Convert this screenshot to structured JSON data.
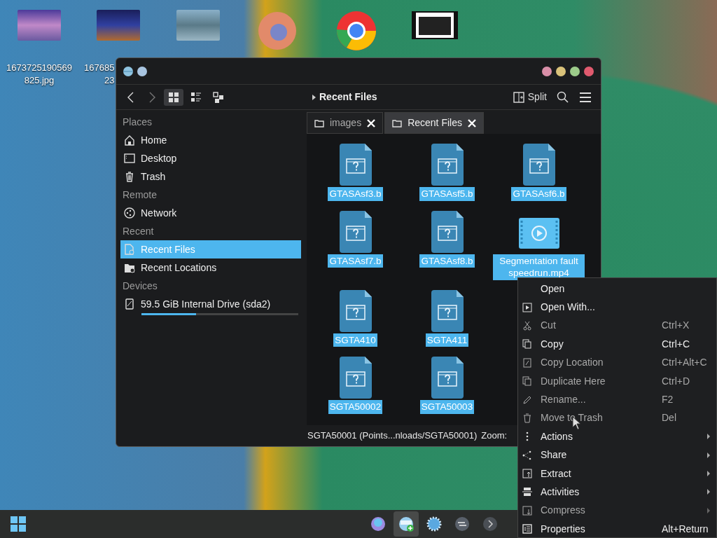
{
  "desktop_icons": [
    {
      "kind": "photo",
      "label_lines": [
        "1673725190569",
        "825.jpg"
      ]
    },
    {
      "kind": "photo",
      "label_lines": [
        "167685",
        "23"
      ]
    },
    {
      "kind": "photo"
    },
    {
      "kind": "browser-fox"
    },
    {
      "kind": "browser-ring"
    },
    {
      "kind": "video"
    }
  ],
  "window": {
    "breadcrumb": "Recent Files",
    "split_label": "Split",
    "view_modes": [
      {
        "kind": "icons",
        "selected": true
      },
      {
        "kind": "details",
        "selected": false
      },
      {
        "kind": "tree",
        "selected": false
      }
    ],
    "window_buttons": [
      {
        "color": "#d98fa8"
      },
      {
        "color": "#d9c27a"
      },
      {
        "color": "#9ccb8a"
      },
      {
        "color": "#e05a6e"
      }
    ]
  },
  "sidebar": {
    "sections": [
      {
        "heading": "Places",
        "items": [
          {
            "label": "Home",
            "kind": "home",
            "selected": false
          },
          {
            "label": "Desktop",
            "kind": "desktop",
            "selected": false
          },
          {
            "label": "Trash",
            "kind": "trash",
            "selected": false
          }
        ]
      },
      {
        "heading": "Remote",
        "items": [
          {
            "label": "Network",
            "kind": "network",
            "selected": false
          }
        ]
      },
      {
        "heading": "Recent",
        "items": [
          {
            "label": "Recent Files",
            "kind": "recent-files",
            "selected": true
          },
          {
            "label": "Recent Locations",
            "kind": "recent-locations",
            "selected": false
          }
        ]
      },
      {
        "heading": "Devices",
        "items": [
          {
            "label": "59.5 GiB Internal Drive (sda2)",
            "kind": "drive",
            "selected": false,
            "level": 0.35
          }
        ]
      }
    ]
  },
  "tabs": [
    {
      "label": "images",
      "selected": false
    },
    {
      "label": "Recent Files",
      "selected": true
    }
  ],
  "files": [
    [
      {
        "name": "GTASAsf3.b",
        "kind": "unknown"
      },
      {
        "name": "GTASAsf5.b",
        "kind": "unknown"
      },
      {
        "name": "GTASAsf6.b",
        "kind": "unknown"
      }
    ],
    [
      {
        "name": "GTASAsf7.b",
        "kind": "unknown"
      },
      {
        "name": "GTASAsf8.b",
        "kind": "unknown"
      },
      {
        "name": "Segmentation fault speedrun.mp4",
        "kind": "video"
      }
    ],
    [
      {
        "name": "SGTA410",
        "kind": "unknown"
      },
      {
        "name": "SGTA411",
        "kind": "unknown"
      }
    ],
    [
      {
        "name": "SGTA50002",
        "kind": "unknown"
      },
      {
        "name": "SGTA50003",
        "kind": "unknown"
      }
    ]
  ],
  "status_bar": {
    "text": "SGTA50001 (Points...nloads/SGTA50001)",
    "zoom_label": "Zoom:"
  },
  "context_menu": [
    {
      "label": "Open",
      "kind": "open",
      "disabled": false,
      "submenu": false
    },
    {
      "label": "Open With...",
      "kind": "open-with",
      "disabled": false,
      "submenu": false
    },
    {
      "label": "Cut",
      "kind": "cut",
      "shortcut": "Ctrl+X",
      "disabled": true,
      "submenu": false
    },
    {
      "label": "Copy",
      "kind": "copy",
      "shortcut": "Ctrl+C",
      "disabled": false,
      "submenu": false
    },
    {
      "label": "Copy Location",
      "kind": "copy-location",
      "shortcut": "Ctrl+Alt+C",
      "disabled": true,
      "submenu": false
    },
    {
      "label": "Duplicate Here",
      "kind": "duplicate",
      "shortcut": "Ctrl+D",
      "disabled": true,
      "submenu": false
    },
    {
      "label": "Rename...",
      "kind": "rename",
      "shortcut": "F2",
      "disabled": true,
      "submenu": false
    },
    {
      "label": "Move to Trash",
      "kind": "trash",
      "shortcut": "Del",
      "disabled": true,
      "submenu": false
    },
    {
      "label": "Actions",
      "kind": "actions",
      "disabled": false,
      "submenu": true
    },
    {
      "label": "Share",
      "kind": "share",
      "disabled": false,
      "submenu": true
    },
    {
      "label": "Extract",
      "kind": "extract",
      "disabled": false,
      "submenu": true
    },
    {
      "label": "Activities",
      "kind": "activities",
      "disabled": false,
      "submenu": true
    },
    {
      "label": "Compress",
      "kind": "compress",
      "disabled": true,
      "submenu": true
    },
    {
      "label": "Properties",
      "kind": "properties",
      "shortcut": "Alt+Return",
      "disabled": false,
      "submenu": false
    }
  ],
  "taskbar": {
    "items": [
      {
        "kind": "globe",
        "selected": false
      },
      {
        "kind": "files",
        "selected": true
      },
      {
        "kind": "gear",
        "selected": false
      },
      {
        "kind": "switch",
        "selected": false
      },
      {
        "kind": "more",
        "selected": false
      }
    ]
  }
}
